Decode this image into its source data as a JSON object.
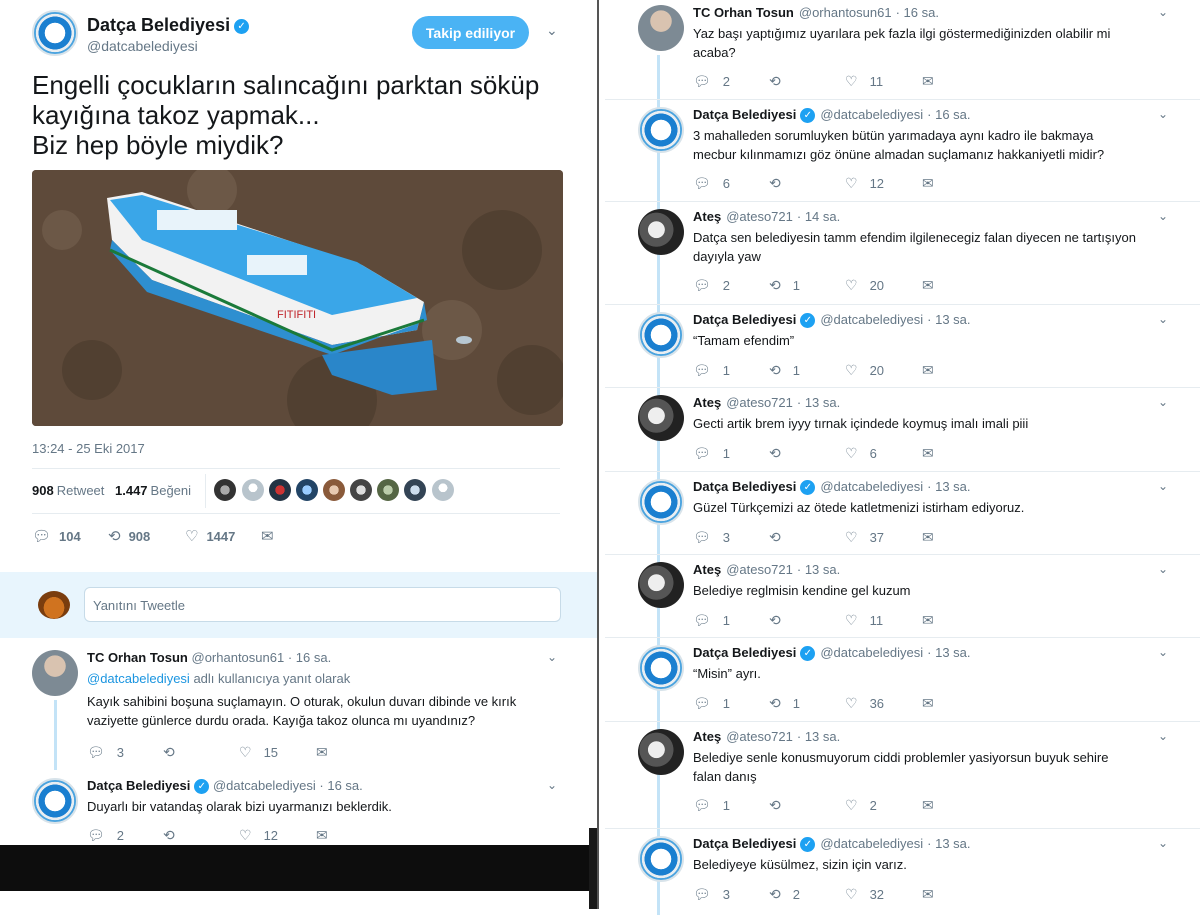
{
  "main_tweet": {
    "name": "Datça Belediyesi",
    "handle": "@datcabelediyesi",
    "follow_label": "Takip ediliyor",
    "text_lines": [
      "Engelli çocukların salıncağını parktan söküp",
      "kayığına takoz yapmak...",
      "Biz hep böyle miydik?"
    ],
    "timestamp": "13:24 - 25 Eki 2017",
    "retweet_count": "908",
    "retweet_label": "Retweet",
    "like_count": "1.447",
    "like_label": "Beğeni",
    "actions": {
      "reply": "104",
      "retweet": "908",
      "like": "1447"
    }
  },
  "reply_box": {
    "placeholder": "Yanıtını Tweetle"
  },
  "left_thread": [
    {
      "name": "TC Orhan Tosun",
      "handle": "@orhantosun61",
      "time": "· 16 sa.",
      "reply_to_handle": "@datcabelediyesi",
      "reply_to_suffix": " adlı kullanıcıya yanıt olarak",
      "lines": [
        "Kayık sahibini boşuna suçlamayın. O oturak, okulun duvarı dibinde ve kırık",
        "vaziyette günlerce durdu orada. Kayığa takoz olunca mı uyandınız?"
      ],
      "reply": "3",
      "retweet": "",
      "like": "15"
    },
    {
      "name": "Datça Belediyesi",
      "handle": "@datcabelediyesi",
      "time": "· 16 sa.",
      "lines": [
        "Duyarlı bir vatandaş olarak bizi uyarmanızı beklerdik."
      ],
      "reply": "2",
      "retweet": "",
      "like": "12"
    }
  ],
  "right_thread": [
    {
      "name": "TC Orhan Tosun",
      "handle": "@orhantosun61",
      "time": "· 16 sa.",
      "verified": false,
      "lines": [
        "Yaz başı yaptığımız uyarılara pek fazla ilgi göstermediğinizden olabilir mi",
        "acaba?"
      ],
      "reply": "2",
      "retweet": "",
      "like": "11"
    },
    {
      "name": "Datça Belediyesi",
      "handle": "@datcabelediyesi",
      "time": "· 16 sa.",
      "verified": true,
      "lines": [
        "3 mahalleden sorumluyken bütün yarımadaya aynı kadro ile bakmaya",
        "mecbur kılınmamızı göz önüne almadan suçlamanız hakkaniyetli midir?"
      ],
      "reply": "6",
      "retweet": "",
      "like": "12"
    },
    {
      "name": "Ateş",
      "handle": "@ateso721",
      "time": "· 14 sa.",
      "verified": false,
      "lines": [
        "Datça sen belediyesin tamm efendim ilgilenecegiz falan diyecen ne tartışıyon",
        "dayıyla yaw"
      ],
      "reply": "2",
      "retweet": "1",
      "like": "20"
    },
    {
      "name": "Datça Belediyesi",
      "handle": "@datcabelediyesi",
      "time": "· 13 sa.",
      "verified": true,
      "lines": [
        "“Tamam efendim”"
      ],
      "reply": "1",
      "retweet": "1",
      "like": "20"
    },
    {
      "name": "Ateş",
      "handle": "@ateso721",
      "time": "· 13 sa.",
      "verified": false,
      "lines": [
        "Gecti artik brem iyyy tırnak içindede koymuş imalı imali piii"
      ],
      "reply": "1",
      "retweet": "",
      "like": "6"
    },
    {
      "name": "Datça Belediyesi",
      "handle": "@datcabelediyesi",
      "time": "· 13 sa.",
      "verified": true,
      "lines": [
        "Güzel Türkçemizi az ötede katletmenizi istirham ediyoruz."
      ],
      "reply": "3",
      "retweet": "",
      "like": "37"
    },
    {
      "name": "Ateş",
      "handle": "@ateso721",
      "time": "· 13 sa.",
      "verified": false,
      "lines": [
        "Belediye reglmisin kendine gel kuzum"
      ],
      "reply": "1",
      "retweet": "",
      "like": "11"
    },
    {
      "name": "Datça Belediyesi",
      "handle": "@datcabelediyesi",
      "time": "· 13 sa.",
      "verified": true,
      "lines": [
        "“Misin” ayrı."
      ],
      "reply": "1",
      "retweet": "1",
      "like": "36"
    },
    {
      "name": "Ateş",
      "handle": "@ateso721",
      "time": "· 13 sa.",
      "verified": false,
      "lines": [
        "Belediye senle konusmuyorum ciddi problemler yasiyorsun buyuk sehire",
        "falan danış"
      ],
      "reply": "1",
      "retweet": "",
      "like": "2"
    },
    {
      "name": "Datça Belediyesi",
      "handle": "@datcabelediyesi",
      "time": "· 13 sa.",
      "verified": true,
      "lines": [
        "Belediyeye küsülmez, sizin için varız."
      ],
      "reply": "3",
      "retweet": "2",
      "like": "32"
    }
  ],
  "colors": {
    "accent": "#1da1f2",
    "follow_bg": "#4ab3f4",
    "muted": "#657786",
    "thread_line": "#c3e3f7"
  },
  "icons": {
    "reply": "reply-icon",
    "retweet": "retweet-icon",
    "like": "heart-icon",
    "dm": "envelope-icon",
    "verified": "verified-badge-icon",
    "caret": "chevron-down-icon"
  }
}
